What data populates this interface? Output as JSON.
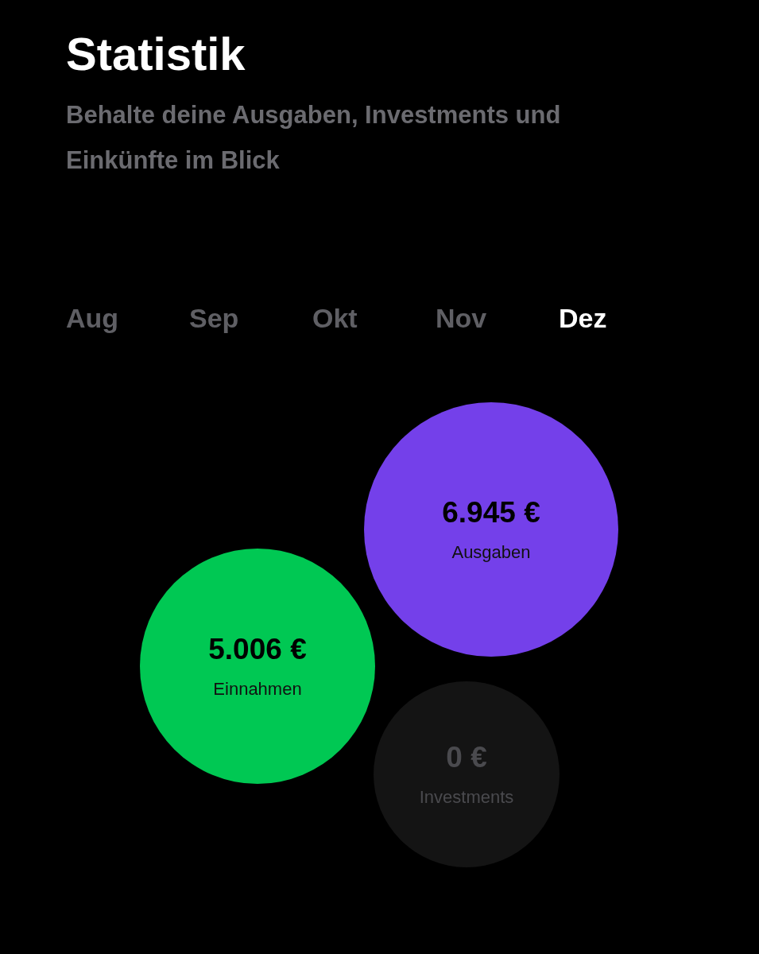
{
  "header": {
    "title": "Statistik",
    "subtitle": "Behalte deine Ausgaben, Investments und Einkünfte im Blick"
  },
  "months": [
    {
      "label": "Aug",
      "selected": false
    },
    {
      "label": "Sep",
      "selected": false
    },
    {
      "label": "Okt",
      "selected": false
    },
    {
      "label": "Nov",
      "selected": false
    },
    {
      "label": "Dez",
      "selected": true
    }
  ],
  "bubbles": [
    {
      "amount": "6.945 €",
      "label": "Ausgaben",
      "color": "#7440ea",
      "dimmed": false
    },
    {
      "amount": "5.006 €",
      "label": "Einnahmen",
      "color": "#00c853",
      "dimmed": false
    },
    {
      "amount": "0 €",
      "label": "Investments",
      "color": "#141414",
      "dimmed": true
    }
  ]
}
